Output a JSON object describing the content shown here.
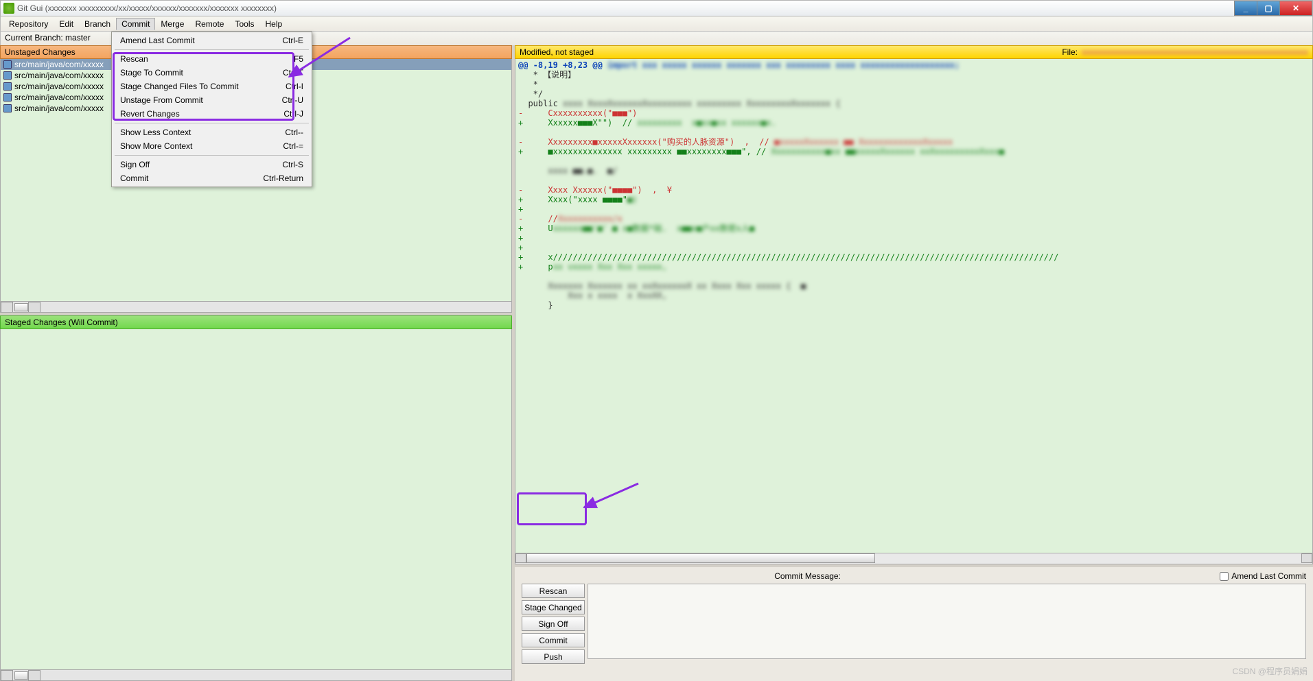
{
  "title": "Git Gui (xxxxxxx xxxxxxxxx/xx/xxxxx/xxxxxx/xxxxxxx/xxxxxxx xxxxxxxx)",
  "menubar": [
    "Repository",
    "Edit",
    "Branch",
    "Commit",
    "Merge",
    "Remote",
    "Tools",
    "Help"
  ],
  "branchbar": "Current Branch: master",
  "left": {
    "unstaged_header": "Unstaged Changes",
    "unstaged_files": [
      "src/main/java/com/xxxxx",
      "src/main/java/com/xxxxx",
      "src/main/java/com/xxxxx",
      "src/main/java/com/xxxxx",
      "src/main/java/com/xxxxx"
    ],
    "staged_header": "Staged Changes (Will Commit)"
  },
  "diff": {
    "header": "Modified, not staged",
    "file_label": "File: ",
    "file_path_blurred": "xxxxxxxxxxxxxxxxxxxxxxxxxxxxxxxxxxxxxxxxxxxxxxxxxxxxxxx",
    "hunk": "@@ -8,19 +8,23 @@ import xxx xxxxx xxxxxx xxxxxxx xxx xxxxxxxxx xxxx xxxxxxxxxxxxxxxxxxx;",
    "lines": [
      {
        "t": "ctx",
        "c": "   * 【说明】"
      },
      {
        "t": "ctx",
        "c": "   *"
      },
      {
        "t": "ctx",
        "c": "   */"
      },
      {
        "t": "ctx",
        "c": "  public xxxx XxxxXxxxxxxXxxxxxxxxx xxxxxxxxx XxxxxxxxxXxxxxxxx {"
      },
      {
        "t": "del",
        "c": "-     Cxxxxxxxxxx(\"■■■\")"
      },
      {
        "t": "add",
        "c": "+     Xxxxxx■■■X\"\")  // xxxxxxxxx  x■xx■xx xxxxxx■x."
      },
      {
        "t": "ctx",
        "c": ""
      },
      {
        "t": "del",
        "c": "-     Xxxxxxxxx■xxxxxXxxxxxx(\"购买的人脉资源\")  ,  // ■xxxxxXxxxxxx ■■ XxxxxxxxxxxxxXxxxxx"
      },
      {
        "t": "add",
        "c": "+     ■xxxxxxxxxxxxxx xxxxxxxxx ■■xxxxxxxx■■■\", // Xxxxxxxxxxx■xx ■■xxxxxXxxxxxx xxXxxxxxxxxxXxxx■"
      },
      {
        "t": "ctx",
        "c": ""
      },
      {
        "t": "ctx",
        "c": "      xxxx ■■.■.  ■/"
      },
      {
        "t": "ctx",
        "c": ""
      },
      {
        "t": "del",
        "c": "-     Xxxx Xxxxxx(\"■■■■\")  ,  ¥"
      },
      {
        "t": "add",
        "c": "+     Xxxx(\"xxxx ■■■■\"■)"
      },
      {
        "t": "add",
        "c": "+"
      },
      {
        "t": "del",
        "c": "-     //Xxxxxxxxxxx/x"
      },
      {
        "t": "add",
        "c": "+     Uxxxxxx■■'■' ■ x■数据*础.  x■■x■户xx数密x人■"
      },
      {
        "t": "add",
        "c": "+"
      },
      {
        "t": "add",
        "c": "+"
      },
      {
        "t": "add",
        "c": "+     x//////////////////////////////////////////////////////////////////////////////////////////////////////"
      },
      {
        "t": "add",
        "c": "+     pxx vxxxx Xxx Xxx xxxxx,"
      },
      {
        "t": "ctx",
        "c": ""
      },
      {
        "t": "ctx",
        "c": "      Xxxxxxx Xxxxxxx xx xxXxxxxxxX xx Xxxx Xxx xxxxx {  ■"
      },
      {
        "t": "ctx",
        "c": "          Xxx x xxxx  x XxxXX,"
      },
      {
        "t": "ctx",
        "c": "      }"
      }
    ]
  },
  "commit_dropdown": {
    "groups": [
      [
        {
          "label": "Amend Last Commit",
          "shortcut": "Ctrl-E"
        }
      ],
      [
        {
          "label": "Rescan",
          "shortcut": "F5"
        },
        {
          "label": "Stage To Commit",
          "shortcut": "Ctrl-T"
        },
        {
          "label": "Stage Changed Files To Commit",
          "shortcut": "Ctrl-I"
        },
        {
          "label": "Unstage From Commit",
          "shortcut": "Ctrl-U"
        },
        {
          "label": "Revert Changes",
          "shortcut": "Ctrl-J"
        }
      ],
      [
        {
          "label": "Show Less Context",
          "shortcut": "Ctrl--"
        },
        {
          "label": "Show More Context",
          "shortcut": "Ctrl-="
        }
      ],
      [
        {
          "label": "Sign Off",
          "shortcut": "Ctrl-S"
        },
        {
          "label": "Commit",
          "shortcut": "Ctrl-Return"
        }
      ]
    ]
  },
  "commitarea": {
    "msg_label": "Commit Message:",
    "amend_label": "Amend Last Commit",
    "buttons": [
      "Rescan",
      "Stage Changed",
      "Sign Off",
      "Commit",
      "Push"
    ]
  },
  "watermark": "CSDN @程序员娟娟"
}
